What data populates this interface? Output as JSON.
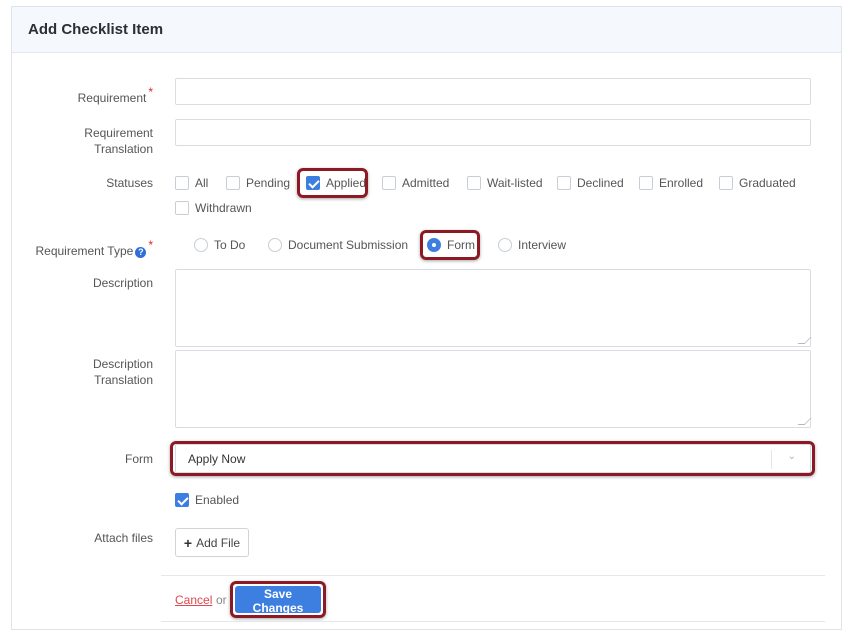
{
  "panel": {
    "title": "Add Checklist Item"
  },
  "fields": {
    "requirement_label": "Requirement",
    "requirement_value": "",
    "translation_label_1": "Requirement",
    "translation_label_2": "Translation",
    "translation_value": "",
    "statuses_label": "Statuses",
    "statuses": [
      {
        "label": "All",
        "checked": false
      },
      {
        "label": "Pending",
        "checked": false
      },
      {
        "label": "Applied",
        "checked": true
      },
      {
        "label": "Admitted",
        "checked": false
      },
      {
        "label": "Wait-listed",
        "checked": false
      },
      {
        "label": "Declined",
        "checked": false
      },
      {
        "label": "Enrolled",
        "checked": false
      },
      {
        "label": "Graduated",
        "checked": false
      },
      {
        "label": "Withdrawn",
        "checked": false
      }
    ],
    "type_label": "Requirement Type",
    "types": [
      {
        "label": "To Do",
        "checked": false
      },
      {
        "label": "Document Submission",
        "checked": false
      },
      {
        "label": "Form",
        "checked": true
      },
      {
        "label": "Interview",
        "checked": false
      }
    ],
    "description_label": "Description",
    "description_translation_label_1": "Description",
    "description_translation_label_2": "Translation",
    "form_label": "Form",
    "form_value": "Apply Now",
    "enabled_label": "Enabled",
    "enabled_checked": true,
    "attach_label": "Attach files",
    "add_file_label": "Add File"
  },
  "actions": {
    "cancel_label": "Cancel",
    "or_text": "or",
    "save_label": "Save Changes"
  },
  "colors": {
    "accent": "#3d7fe0",
    "highlight": "#8b1a24",
    "required": "#e02424",
    "cancel": "#e0484e"
  },
  "icons": {
    "help": "question-circle-icon",
    "chevron": "chevron-down-icon",
    "plus": "plus-icon",
    "resize": "resize-grip-icon"
  }
}
